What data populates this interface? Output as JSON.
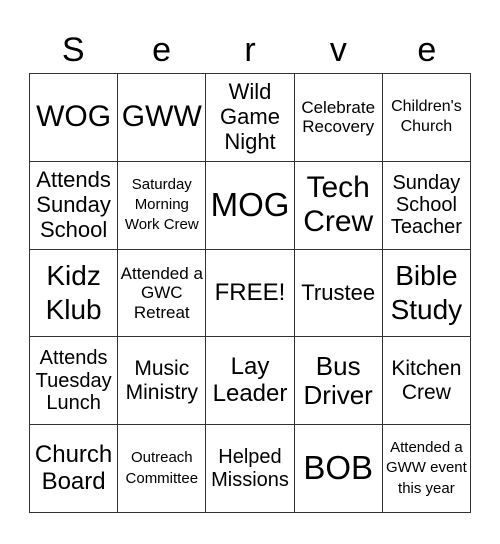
{
  "title": {
    "letters": [
      "S",
      "e",
      "r",
      "v",
      "e"
    ]
  },
  "board": {
    "rows": [
      [
        "WOG",
        "GWW",
        "Wild Game Night",
        "Celebrate Recovery",
        "Children's Church"
      ],
      [
        "Attends Sunday School",
        "Saturday Morning Work Crew",
        "MOG",
        "Tech Crew",
        "Sunday School Teacher"
      ],
      [
        "Kidz Klub",
        "Attended a GWC Retreat",
        "FREE!",
        "Trustee",
        "Bible Study"
      ],
      [
        "Attends Tuesday Lunch",
        "Music Ministry",
        "Lay Leader",
        "Bus Driver",
        "Kitchen Crew"
      ],
      [
        "Church Board",
        "Outreach Committee",
        "Helped Missions",
        "BOB",
        "Attended a GWW event this year"
      ]
    ]
  },
  "colors": {
    "grid_line": "#333333",
    "text": "#000000",
    "background": "#ffffff"
  }
}
